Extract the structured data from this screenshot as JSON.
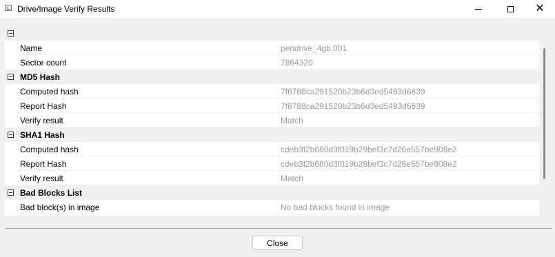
{
  "window": {
    "title": "Drive/Image Verify Results",
    "icon": "app-window-icon",
    "controls": [
      "minimize",
      "maximize",
      "close"
    ]
  },
  "tree": {
    "root": {
      "label": "",
      "rows": [
        {
          "name": "Name",
          "value": "pendrive_4gb.001"
        },
        {
          "name": "Sector count",
          "value": "7864320"
        }
      ]
    },
    "md5": {
      "label": "MD5 Hash",
      "rows": [
        {
          "name": "Computed hash",
          "value": "7f6788ca291520b23b6d3ed5493d6839"
        },
        {
          "name": "Report Hash",
          "value": "7f6788ca291520b23b6d3ed5493d6839"
        },
        {
          "name": "Verify result",
          "value": "Match"
        }
      ]
    },
    "sha1": {
      "label": "SHA1 Hash",
      "rows": [
        {
          "name": "Computed hash",
          "value": "cdeb3f2b680d3f019b29bef3c7d26e557be908e2"
        },
        {
          "name": "Report Hash",
          "value": "cdeb3f2b680d3f019b29bef3c7d26e557be908e2"
        },
        {
          "name": "Verify result",
          "value": "Match"
        }
      ]
    },
    "badblocks": {
      "label": "Bad Blocks List",
      "rows": [
        {
          "name": "Bad block(s) in image",
          "value": "No bad blocks found in image"
        }
      ]
    }
  },
  "footer": {
    "close_label": "Close"
  },
  "colors": {
    "value_text": "#9a9a9a",
    "section_bg": "#f0f0f0"
  }
}
